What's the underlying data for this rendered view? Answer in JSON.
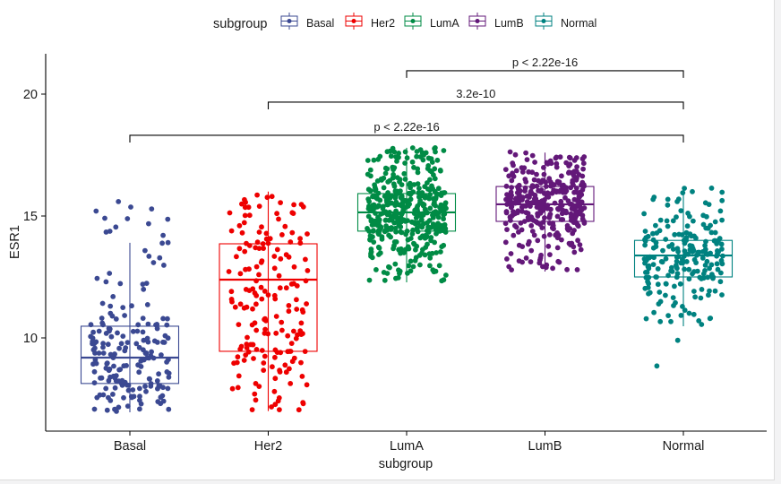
{
  "chart_data": {
    "type": "boxplot",
    "title": "",
    "xlabel": "subgroup",
    "ylabel": "ESR1",
    "ylim": [
      6.5,
      21.6
    ],
    "yticks": [
      10,
      15,
      20
    ],
    "ytick_labels": [
      "10",
      "15",
      "20"
    ],
    "categories": [
      "Basal",
      "Her2",
      "LumA",
      "LumB",
      "Normal"
    ],
    "legend": {
      "title": "subgroup",
      "placement": "top",
      "entries": [
        "Basal",
        "Her2",
        "LumA",
        "LumB",
        "Normal"
      ]
    },
    "colors": {
      "Basal": "#3B4992",
      "Her2": "#EE0000",
      "LumA": "#008B45",
      "LumB": "#631879",
      "Normal": "#008280"
    },
    "series": [
      {
        "name": "Basal",
        "whisker_low": 6.95,
        "q1": 8.13,
        "median": 9.19,
        "q3": 10.48,
        "whisker_high": 13.9,
        "points_max": 15.8,
        "n_points_approx": 190
      },
      {
        "name": "Her2",
        "whisker_low": 7.0,
        "q1": 9.45,
        "median": 12.39,
        "q3": 13.86,
        "whisker_high": 16.0,
        "points_max": 16.0,
        "n_points_approx": 180
      },
      {
        "name": "LumA",
        "whisker_low": 12.28,
        "q1": 14.38,
        "median": 15.15,
        "q3": 15.92,
        "whisker_high": 17.8,
        "points_min": 12.0,
        "points_max": 17.8,
        "n_points_approx": 420
      },
      {
        "name": "LumB",
        "whisker_low": 12.72,
        "q1": 14.78,
        "median": 15.48,
        "q3": 16.21,
        "whisker_high": 17.6,
        "points_min": 12.7,
        "points_max": 17.65,
        "n_points_approx": 330
      },
      {
        "name": "Normal",
        "whisker_low": 10.48,
        "q1": 12.5,
        "median": 13.38,
        "q3": 14.0,
        "whisker_high": 16.03,
        "points_max": 16.35,
        "outliers": [
          9.9,
          8.85
        ],
        "n_points_approx": 210
      }
    ],
    "comparisons": [
      {
        "group1": "LumA",
        "group2": "Normal",
        "label": "p < 2.22e-16",
        "y": 20.96
      },
      {
        "group1": "Her2",
        "group2": "Normal",
        "label": "3.2e-10",
        "y": 19.67
      },
      {
        "group1": "Basal",
        "group2": "Normal",
        "label": "p < 2.22e-16",
        "y": 18.31
      }
    ],
    "grid": false
  }
}
